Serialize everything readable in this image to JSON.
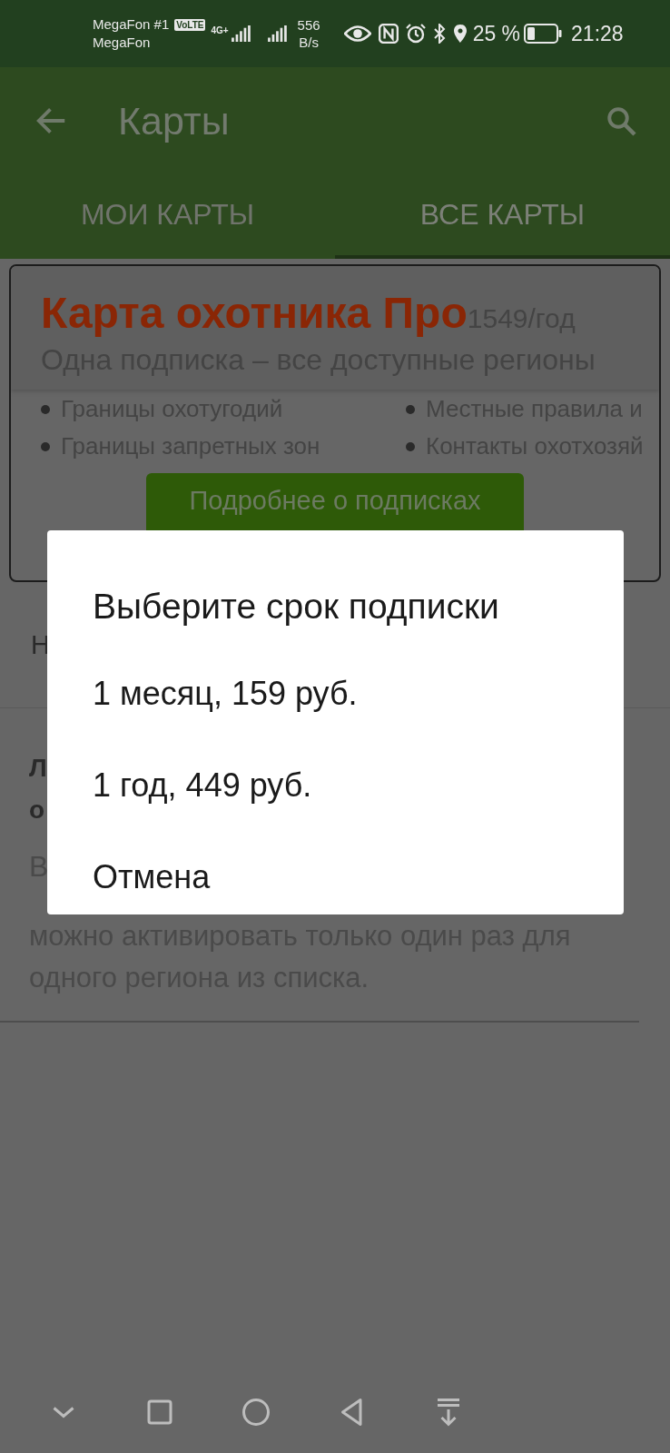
{
  "status_bar": {
    "carrier_1": "MegaFon #1",
    "volte_badge": "VoLTE",
    "network_type": "4G+",
    "carrier_2": "MegaFon",
    "speed_value": "556",
    "speed_unit": "B/s",
    "battery": "25 %",
    "time": "21:28"
  },
  "app_bar": {
    "title": "Карты"
  },
  "tabs": [
    {
      "label": "МОИ КАРТЫ",
      "selected": false
    },
    {
      "label": "ВСЕ КАРТЫ",
      "selected": true
    }
  ],
  "promo_card": {
    "title": "Карта охотника Про",
    "price": "1549/год",
    "subtitle": "Одна подписка – все доступные регионы",
    "features": [
      "Границы охотугодий",
      "Местные правила и",
      "Границы запретных зон",
      "Контакты охотхозяй"
    ],
    "button": "Подробнее о подписках"
  },
  "content": {
    "row_1": "Н",
    "heading_line_1": "Л",
    "heading_line_2": "о",
    "paragraph_line_1": "В",
    "paragraph_rest": "можно активировать только один раз для одного региона из списка."
  },
  "dialog": {
    "title": "Выберите срок подписки",
    "options": [
      "1 месяц, 159 руб.",
      "1 год, 449 руб."
    ],
    "cancel": "Отмена"
  }
}
